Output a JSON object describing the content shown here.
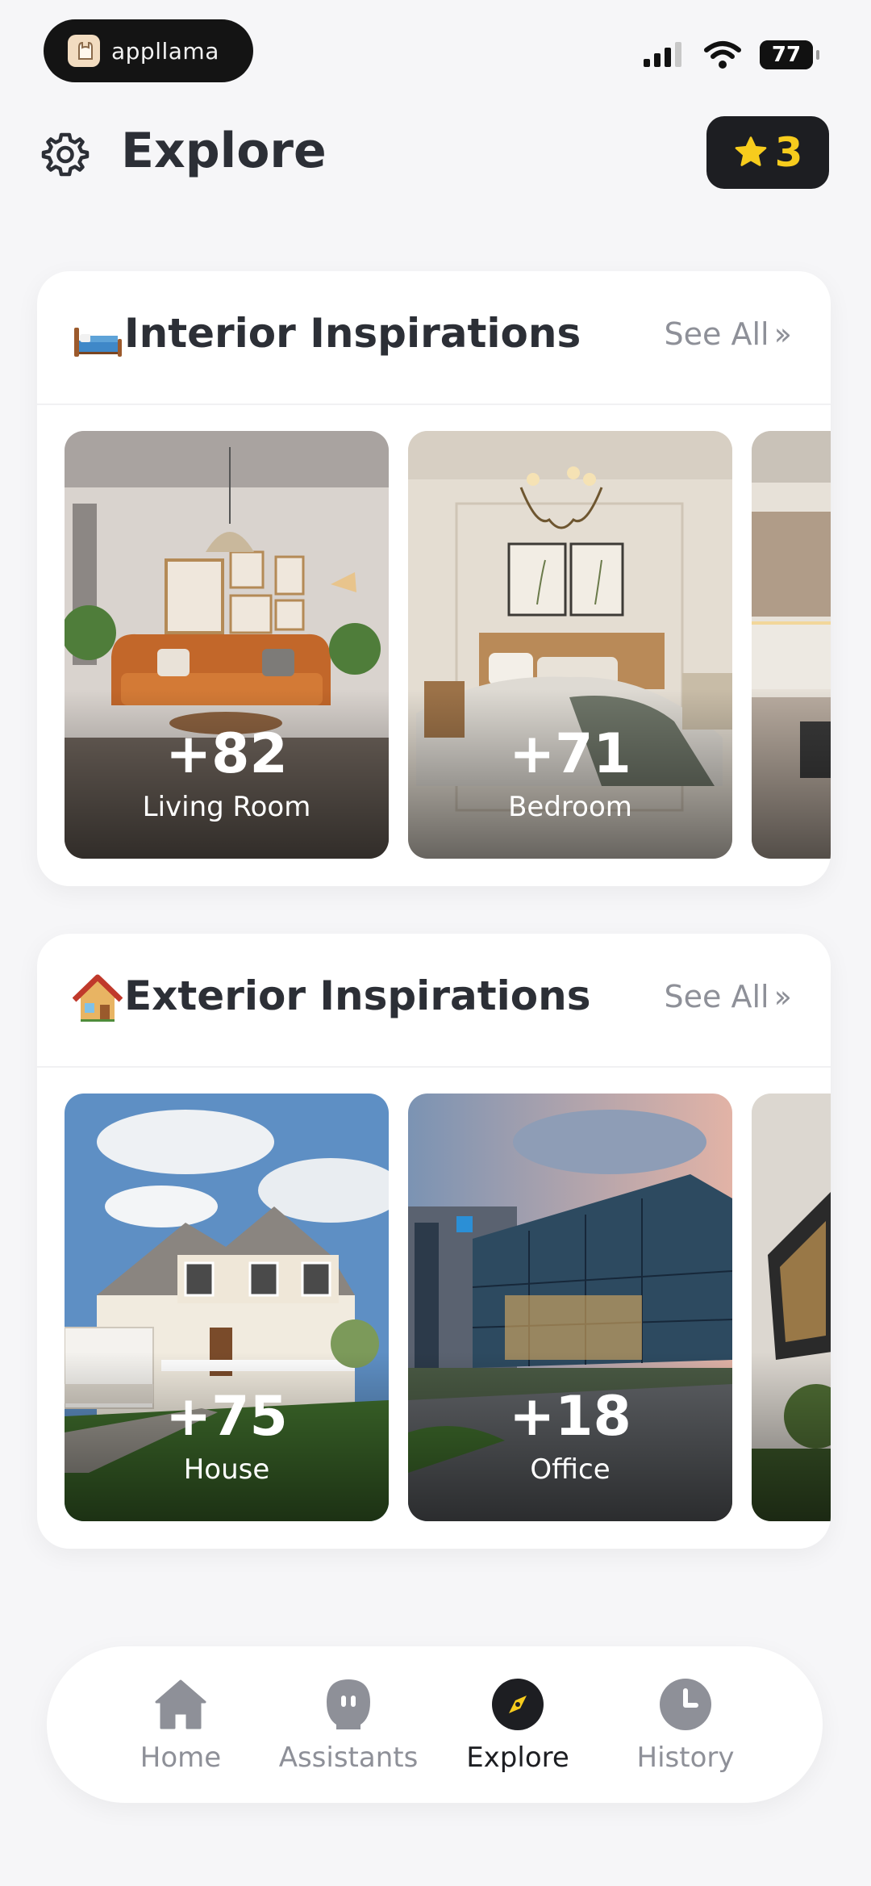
{
  "status_bar": {
    "app_name": "appllama",
    "battery": "77"
  },
  "header": {
    "title": "Explore",
    "stars_count": "3",
    "icons": {
      "settings": "gear-icon",
      "stars": "star-icon"
    }
  },
  "sections": [
    {
      "title": "Interior Inspirations",
      "emoji": "bed-emoji",
      "see_all": "See All",
      "tiles": [
        {
          "count": "+82",
          "label": "Living Room"
        },
        {
          "count": "+71",
          "label": "Bedroom"
        },
        {
          "count": "",
          "label": ""
        }
      ]
    },
    {
      "title": "Exterior Inspirations",
      "emoji": "house-emoji",
      "see_all": "See All",
      "tiles": [
        {
          "count": "+75",
          "label": "House"
        },
        {
          "count": "+18",
          "label": "Office"
        },
        {
          "count": "",
          "label": ""
        }
      ]
    }
  ],
  "bottom_nav": {
    "items": [
      {
        "label": "Home",
        "icon": "home-icon"
      },
      {
        "label": "Assistants",
        "icon": "assistant-icon"
      },
      {
        "label": "Explore",
        "icon": "compass-icon",
        "active": true
      },
      {
        "label": "History",
        "icon": "clock-icon"
      }
    ]
  },
  "colors": {
    "star": "#f7cc1d",
    "nav_inactive": "#8e9098",
    "nav_active": "#1d1e22"
  }
}
